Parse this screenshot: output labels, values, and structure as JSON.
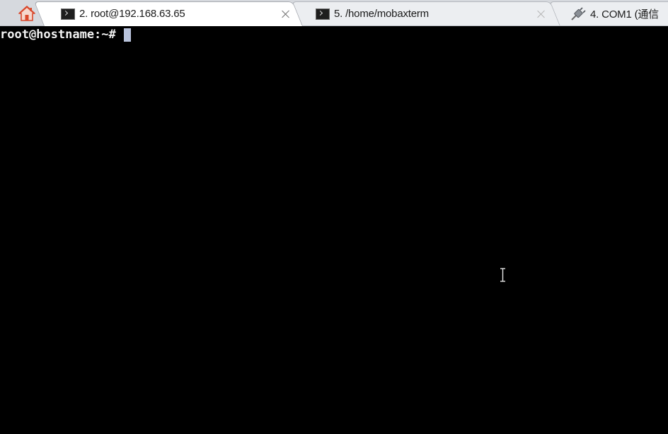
{
  "tabs": [
    {
      "id": "home",
      "icon": "home-icon"
    },
    {
      "id": "ssh",
      "label": "2. root@192.168.63.65",
      "icon": "terminal-icon",
      "active": true
    },
    {
      "id": "local",
      "label": "5. /home/mobaxterm",
      "icon": "terminal-icon",
      "active": false
    },
    {
      "id": "serial",
      "label": "4. COM1  (通信",
      "icon": "serial-plug-icon",
      "active": false
    }
  ],
  "terminal": {
    "prompt": "root@hostname:~# "
  },
  "colors": {
    "terminal_bg": "#000000",
    "terminal_fg": "#f2f2f2",
    "cursor": "#b9c3dc",
    "tabbar_bg": "#d6d9de",
    "tab_active_bg": "#ffffff",
    "tab_inactive_bg": "#eceef1",
    "home_icon": "#d9482b"
  }
}
